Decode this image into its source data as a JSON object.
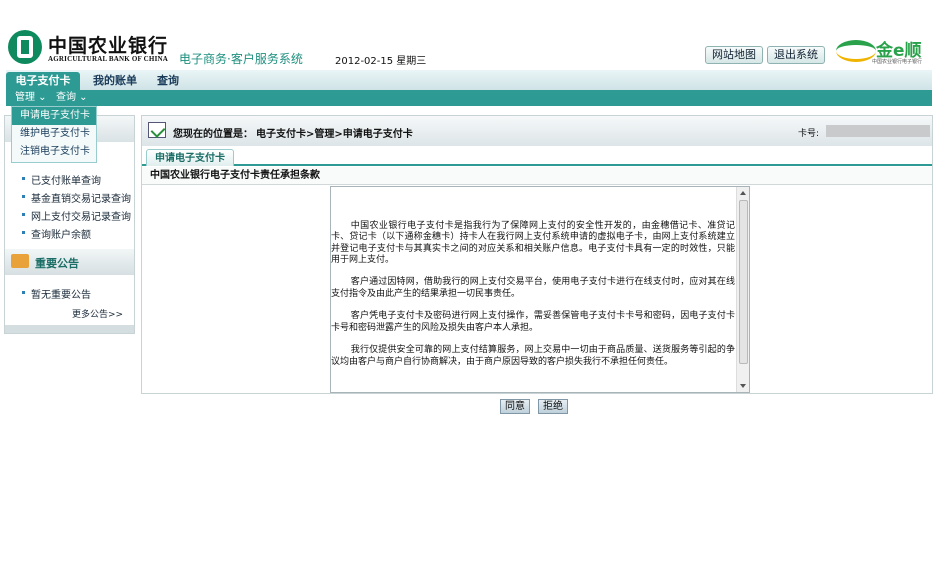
{
  "header": {
    "bank_name_cn": "中国农业银行",
    "bank_name_en": "AGRICULTURAL BANK OF CHINA",
    "system_name": "电子商务·客户服务系统",
    "date": "2012-02-15 星期三",
    "sitemap_label": "网站地图",
    "logout_label": "退出系统",
    "brand_name": "金e顺",
    "brand_subtitle": "中国农业银行电子银行",
    "colors": {
      "accent": "#2d9a94",
      "brand_green": "#2aa24b",
      "logo_green": "#0f8a5f"
    }
  },
  "nav": {
    "tabs": [
      {
        "label": "电子支付卡",
        "active": true
      },
      {
        "label": "我的账单",
        "active": false
      },
      {
        "label": "查询",
        "active": false
      }
    ],
    "subnav": [
      {
        "label": "管理 ⌄"
      },
      {
        "label": "查询 ⌄"
      }
    ],
    "dropdown": [
      {
        "label": "申请电子支付卡",
        "selected": true
      },
      {
        "label": "维护电子支付卡",
        "selected": false
      },
      {
        "label": "注销电子支付卡",
        "selected": false
      }
    ]
  },
  "sidebar": {
    "links": [
      {
        "label": "已支付账单查询"
      },
      {
        "label": "基金直销交易记录查询"
      },
      {
        "label": "网上支付交易记录查询"
      },
      {
        "label": "查询账户余额"
      }
    ],
    "announcement_title": "重要公告",
    "announcements": [
      {
        "label": "暂无重要公告"
      }
    ],
    "more_label": "更多公告>>"
  },
  "main": {
    "location_label": "您现在的位置是：",
    "location_path": "电子支付卡>管理>申请电子支付卡",
    "card_label": "卡号:",
    "tab_label": "申请电子支付卡",
    "section_title": "中国农业银行电子支付卡责任承担条款",
    "terms": [
      "中国农业银行电子支付卡是指我行为了保障网上支付的安全性开发的，由金穗借记卡、准贷记卡、贷记卡（以下通称金穗卡）持卡人在我行网上支付系统申请的虚拟电子卡，由网上支付系统建立并登记电子支付卡与其真实卡之间的对应关系和相关账户信息。电子支付卡具有一定的时效性，只能用于网上支付。",
      "客户通过因特网，借助我行的网上支付交易平台，使用电子支付卡进行在线支付时，应对其在线支付指令及由此产生的结果承担一切民事责任。",
      "客户凭电子支付卡及密码进行网上支付操作，需妥善保管电子支付卡卡号和密码，因电子支付卡卡号和密码泄露产生的风险及损失由客户本人承担。",
      "我行仅提供安全可靠的网上支付结算服务，网上交易中一切由于商品质量、送货服务等引起的争议均由客户与商户自行协商解决，由于商户原因导致的客户损失我行不承担任何责任。"
    ],
    "agree_label": "同意",
    "refuse_label": "拒绝"
  }
}
